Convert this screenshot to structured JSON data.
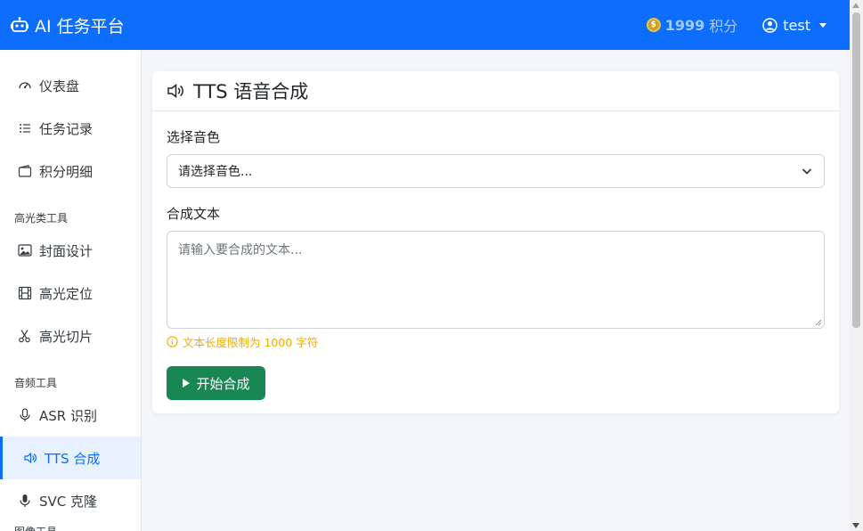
{
  "navbar": {
    "brand": "AI 任务平台",
    "points_value": "1999",
    "points_unit": "积分",
    "user": "test"
  },
  "sidebar": {
    "items": [
      {
        "label": "仪表盘",
        "icon": "speedometer-icon"
      },
      {
        "label": "任务记录",
        "icon": "list-icon"
      },
      {
        "label": "积分明细",
        "icon": "wallet-icon"
      }
    ],
    "section_highlight": "高光类工具",
    "highlight_items": [
      {
        "label": "封面设计",
        "icon": "image-icon"
      },
      {
        "label": "高光定位",
        "icon": "film-icon"
      },
      {
        "label": "高光切片",
        "icon": "scissors-icon"
      }
    ],
    "section_audio": "音频工具",
    "audio_items": [
      {
        "label": "ASR 识别",
        "icon": "mic-icon"
      },
      {
        "label": "TTS 合成",
        "icon": "volume-icon",
        "active": true
      },
      {
        "label": "SVC 克隆",
        "icon": "mic-fill-icon"
      }
    ],
    "section_image": "图像工具"
  },
  "main": {
    "title": "TTS 语音合成",
    "voice_label": "选择音色",
    "voice_select": "请选择音色...",
    "text_label": "合成文本",
    "text_placeholder": "请输入要合成的文本...",
    "hint": "文本长度限制为 1000 字符",
    "submit": "开始合成"
  },
  "colors": {
    "primary": "#0d6efd",
    "success": "#198754",
    "warning": "#f0ad00",
    "active_bg": "#e7f1ff"
  }
}
